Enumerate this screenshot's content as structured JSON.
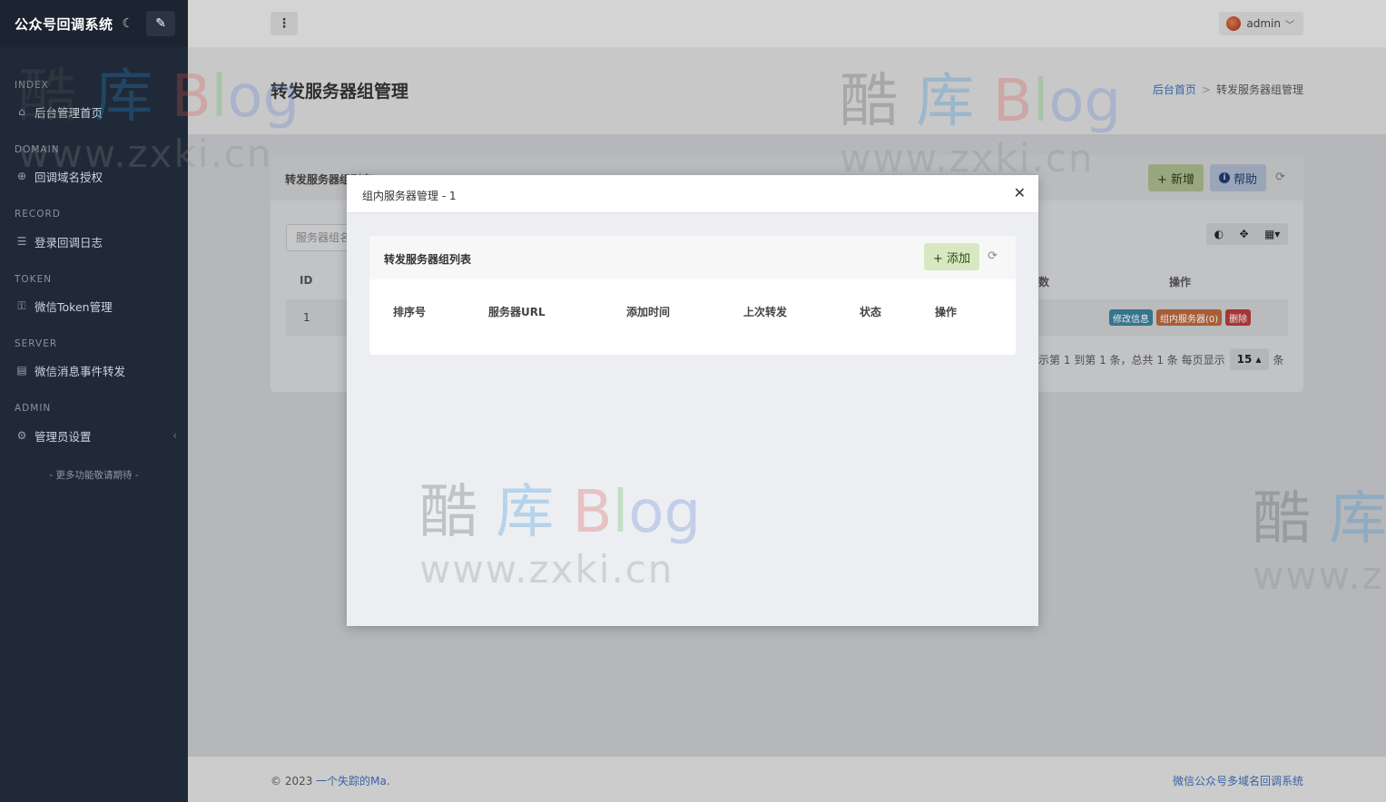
{
  "brand": {
    "title": "公众号回调系统",
    "moon_icon": "moon-icon",
    "brush_icon": "brush-icon"
  },
  "sidebar": {
    "sections": [
      {
        "label": "INDEX",
        "item": "后台管理首页",
        "icon": "home-icon"
      },
      {
        "label": "DOMAIN",
        "item": "回调域名授权",
        "icon": "globe-icon"
      },
      {
        "label": "RECORD",
        "item": "登录回调日志",
        "icon": "list-icon"
      },
      {
        "label": "TOKEN",
        "item": "微信Token管理",
        "icon": "key-icon"
      },
      {
        "label": "SERVER",
        "item": "微信消息事件转发",
        "icon": "server-icon"
      },
      {
        "label": "ADMIN",
        "item": "管理员设置",
        "icon": "gear-icon",
        "arrow": "‹"
      }
    ],
    "more": "- 更多功能敬请期待 -"
  },
  "topbar": {
    "kebab": "⋮",
    "user": "admin"
  },
  "page": {
    "title": "转发服务器组管理",
    "breadcrumb": {
      "home": "后台首页",
      "sep": ">",
      "current": "转发服务器组管理"
    }
  },
  "card": {
    "title": "转发服务器组列表",
    "add_label": "+ 新增",
    "help_label": "帮助",
    "search_placeholder": "服务器组名",
    "headers": {
      "id": "ID",
      "count": "数",
      "op": "操作"
    },
    "row": {
      "id": "1",
      "edit": "修改信息",
      "servers": "组内服务器(0)",
      "delete": "删除"
    },
    "pager": {
      "prefix": "示第 1 到第 1 条，总共 1 条  每页显示",
      "size": "15 ▴",
      "suffix": "条"
    }
  },
  "footer": {
    "copy": "© 2023 ",
    "author": "一个失踪的Ma.",
    "right": "微信公众号多域名回调系统"
  },
  "watermark": {
    "line1_a": "酷",
    "line1_b": "库",
    "line1_c": "B",
    "line1_d": "l",
    "line1_e": "og",
    "line2": "www.zxki.cn"
  },
  "modal": {
    "title": "组内服务器管理 - 1",
    "close": "✕",
    "inner_title": "转发服务器组列表",
    "add_label": "+ 添加",
    "columns": [
      "排序号",
      "服务器URL",
      "添加时间",
      "上次转发",
      "状态",
      "操作"
    ]
  }
}
